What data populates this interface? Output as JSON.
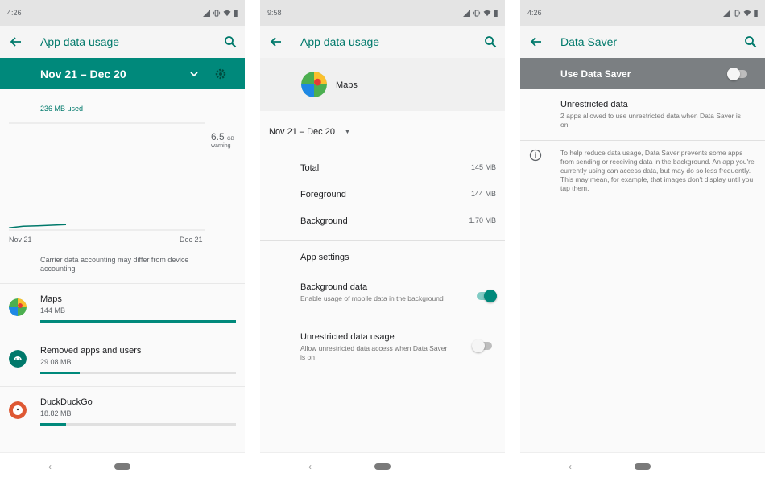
{
  "colors": {
    "accent": "#00897b",
    "accent_dark": "#00796b",
    "disabled_bar": "#7b7f82"
  },
  "panel1": {
    "time": "4:26",
    "title": "App data usage",
    "cycle": "Nov 21 – Dec 20",
    "used": "236 MB used",
    "warning_value": "6.5",
    "warning_unit": "GB",
    "warning_label": "warning",
    "x_start": "Nov 21",
    "x_end": "Dec 21",
    "usage_curve": [
      0.02,
      0.035,
      0.04,
      0.045,
      0.05
    ],
    "note": "Carrier data accounting may differ from device accounting",
    "apps": [
      {
        "name": "Maps",
        "size": "144 MB",
        "fraction": 1.0,
        "icon": "google-maps-icon"
      },
      {
        "name": "Removed apps and users",
        "size": "29.08 MB",
        "fraction": 0.2,
        "icon": "android-icon"
      },
      {
        "name": "DuckDuckGo",
        "size": "18.82 MB",
        "fraction": 0.13,
        "icon": "duckduckgo-icon"
      }
    ]
  },
  "panel2": {
    "time": "9:58",
    "title": "App data usage",
    "app_name": "Maps",
    "cycle": "Nov 21 – Dec 20",
    "stats": [
      {
        "label": "Total",
        "value": "145 MB"
      },
      {
        "label": "Foreground",
        "value": "144 MB"
      },
      {
        "label": "Background",
        "value": "1.70 MB"
      }
    ],
    "app_settings": "App settings",
    "background_data": {
      "title": "Background data",
      "subtitle": "Enable usage of mobile data in the background",
      "on": true
    },
    "unrestricted": {
      "title": "Unrestricted data usage",
      "subtitle": "Allow unrestricted data access when Data Saver is on",
      "on": false
    }
  },
  "panel3": {
    "time": "4:26",
    "title": "Data Saver",
    "use_data_saver": "Use Data Saver",
    "use_data_saver_on": false,
    "unrestricted_title": "Unrestricted data",
    "unrestricted_sub": "2 apps allowed to use unrestricted data when Data Saver is on",
    "info": "To help reduce data usage, Data Saver prevents some apps from sending or receiving data in the background. An app you're currently using can access data, but may do so less frequently. This may mean, for example, that images don't display until you tap them."
  },
  "nav": {
    "back_glyph": "‹"
  }
}
